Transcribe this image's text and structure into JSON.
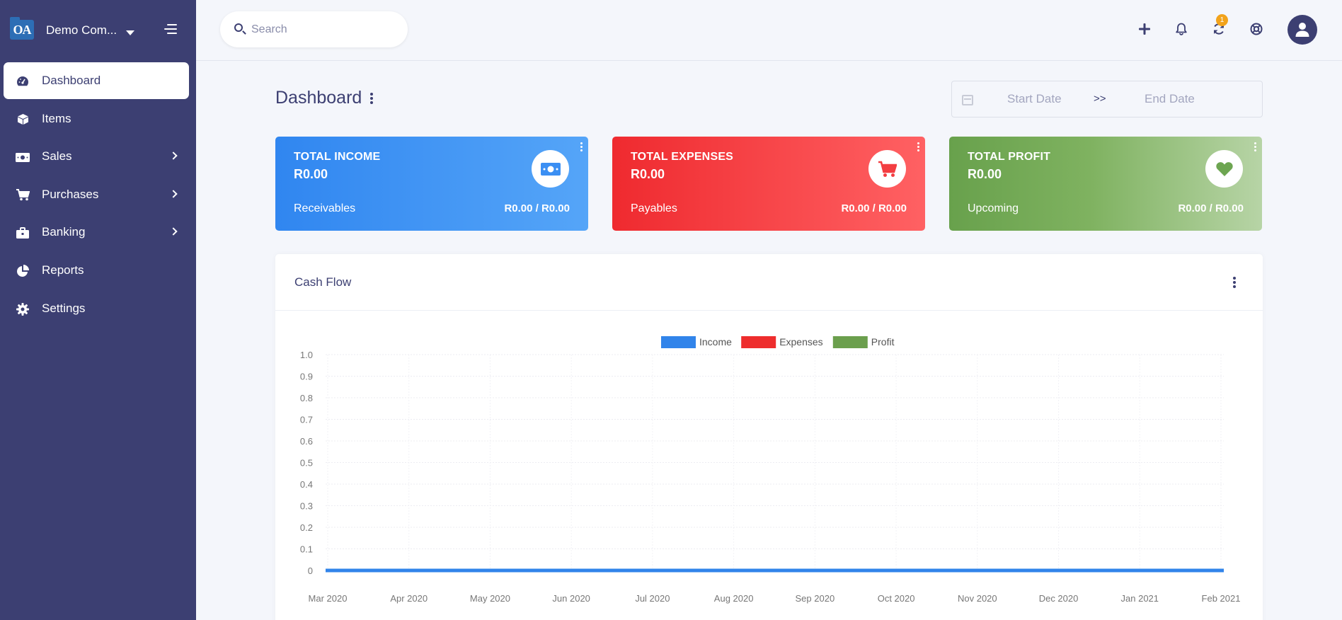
{
  "sidebar": {
    "company_name": "Demo Com...",
    "logo_text": "OA",
    "items": [
      {
        "label": "Dashboard",
        "icon": "dashboard-icon",
        "active": true
      },
      {
        "label": "Items",
        "icon": "box-icon"
      },
      {
        "label": "Sales",
        "icon": "money-icon",
        "has_submenu": true
      },
      {
        "label": "Purchases",
        "icon": "cart-icon",
        "has_submenu": true
      },
      {
        "label": "Banking",
        "icon": "briefcase-icon",
        "has_submenu": true
      },
      {
        "label": "Reports",
        "icon": "pie-chart-icon"
      },
      {
        "label": "Settings",
        "icon": "gear-icon"
      }
    ]
  },
  "header": {
    "search_placeholder": "Search",
    "icons": [
      "plus-icon",
      "bell-icon",
      "sync-icon",
      "help-icon",
      "user-avatar-icon"
    ],
    "sync_badge": "1"
  },
  "page": {
    "title": "Dashboard",
    "date_start_placeholder": "Start Date",
    "date_separator": ">>",
    "date_end_placeholder": "End Date"
  },
  "cards": {
    "income": {
      "title": "TOTAL INCOME",
      "amount": "R0.00",
      "sub_label": "Receivables",
      "sub_value": "R0.00 / R0.00",
      "color": "#3b8ff3",
      "icon": "money-icon"
    },
    "expenses": {
      "title": "TOTAL EXPENSES",
      "amount": "R0.00",
      "sub_label": "Payables",
      "sub_value": "R0.00 / R0.00",
      "color": "#f33e42",
      "icon": "cart-icon"
    },
    "profit": {
      "title": "TOTAL PROFIT",
      "amount": "R0.00",
      "sub_label": "Upcoming",
      "sub_value": "R0.00 / R0.00",
      "color": "#6da551",
      "icon": "heart-icon"
    }
  },
  "cash_flow": {
    "title": "Cash Flow"
  },
  "colors": {
    "sidebar": "#3c3f72",
    "income": "#3184ea",
    "expenses": "#ee2d2d",
    "profit": "#6b9f4d"
  },
  "chart_data": {
    "type": "line",
    "categories": [
      "Mar 2020",
      "Apr 2020",
      "May 2020",
      "Jun 2020",
      "Jul 2020",
      "Aug 2020",
      "Sep 2020",
      "Oct 2020",
      "Nov 2020",
      "Dec 2020",
      "Jan 2021",
      "Feb 2021"
    ],
    "series": [
      {
        "name": "Income",
        "color": "#3184ea",
        "values": [
          0,
          0,
          0,
          0,
          0,
          0,
          0,
          0,
          0,
          0,
          0,
          0
        ]
      },
      {
        "name": "Expenses",
        "color": "#ee2d2d",
        "values": [
          0,
          0,
          0,
          0,
          0,
          0,
          0,
          0,
          0,
          0,
          0,
          0
        ]
      },
      {
        "name": "Profit",
        "color": "#6b9f4d",
        "values": [
          0,
          0,
          0,
          0,
          0,
          0,
          0,
          0,
          0,
          0,
          0,
          0
        ]
      }
    ],
    "yticks": [
      "1.0",
      "0.9",
      "0.8",
      "0.7",
      "0.6",
      "0.5",
      "0.4",
      "0.3",
      "0.2",
      "0.1",
      "0"
    ],
    "ylim": [
      0,
      1.0
    ],
    "legend": "top-center",
    "grid": true
  }
}
